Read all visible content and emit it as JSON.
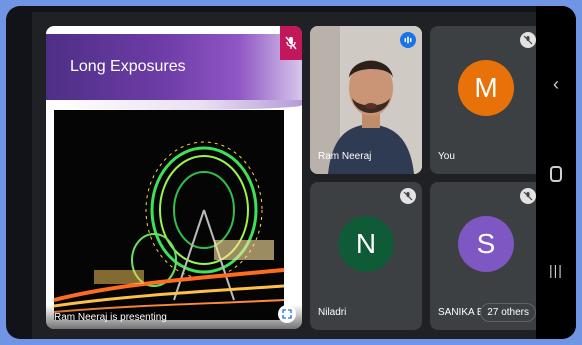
{
  "presentation": {
    "slide_title": "Long Exposures",
    "presenting_label": "Ram Neeraj is presenting"
  },
  "participants": [
    {
      "name": "Ram Neeraj"
    },
    {
      "name": "You",
      "initial": "M",
      "color": "#e8710a"
    },
    {
      "name": "Niladri",
      "initial": "N",
      "color": "#0f5b38"
    },
    {
      "name": "SANIKA B",
      "initial": "S",
      "color": "#7e57c2"
    }
  ],
  "others_count_label": "27 others",
  "icons": {
    "mic_off": "mic-off-icon",
    "speaking": "speaking-icon",
    "fullscreen": "fullscreen-icon",
    "nav_back": "back-icon",
    "nav_home": "home-icon",
    "nav_recents": "recents-icon"
  }
}
